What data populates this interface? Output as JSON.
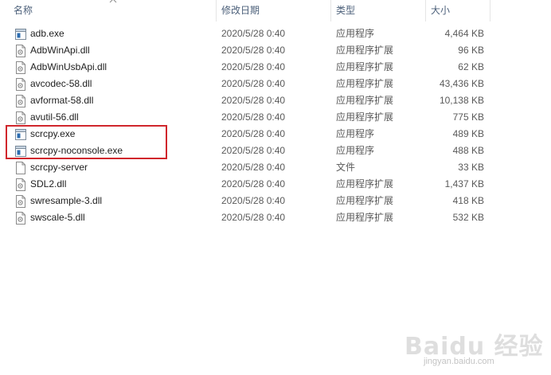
{
  "columns": {
    "name": "名称",
    "date": "修改日期",
    "type": "类型",
    "size": "大小"
  },
  "files": [
    {
      "name": "adb.exe",
      "date": "2020/5/28 0:40",
      "type": "应用程序",
      "size": "4,464 KB",
      "icon": "exe-icon"
    },
    {
      "name": "AdbWinApi.dll",
      "date": "2020/5/28 0:40",
      "type": "应用程序扩展",
      "size": "96 KB",
      "icon": "dll-icon"
    },
    {
      "name": "AdbWinUsbApi.dll",
      "date": "2020/5/28 0:40",
      "type": "应用程序扩展",
      "size": "62 KB",
      "icon": "dll-icon"
    },
    {
      "name": "avcodec-58.dll",
      "date": "2020/5/28 0:40",
      "type": "应用程序扩展",
      "size": "43,436 KB",
      "icon": "dll-icon"
    },
    {
      "name": "avformat-58.dll",
      "date": "2020/5/28 0:40",
      "type": "应用程序扩展",
      "size": "10,138 KB",
      "icon": "dll-icon"
    },
    {
      "name": "avutil-56.dll",
      "date": "2020/5/28 0:40",
      "type": "应用程序扩展",
      "size": "775 KB",
      "icon": "dll-icon"
    },
    {
      "name": "scrcpy.exe",
      "date": "2020/5/28 0:40",
      "type": "应用程序",
      "size": "489 KB",
      "icon": "exe-icon"
    },
    {
      "name": "scrcpy-noconsole.exe",
      "date": "2020/5/28 0:40",
      "type": "应用程序",
      "size": "488 KB",
      "icon": "exe-icon"
    },
    {
      "name": "scrcpy-server",
      "date": "2020/5/28 0:40",
      "type": "文件",
      "size": "33 KB",
      "icon": "file-icon"
    },
    {
      "name": "SDL2.dll",
      "date": "2020/5/28 0:40",
      "type": "应用程序扩展",
      "size": "1,437 KB",
      "icon": "dll-icon"
    },
    {
      "name": "swresample-3.dll",
      "date": "2020/5/28 0:40",
      "type": "应用程序扩展",
      "size": "418 KB",
      "icon": "dll-icon"
    },
    {
      "name": "swscale-5.dll",
      "date": "2020/5/28 0:40",
      "type": "应用程序扩展",
      "size": "532 KB",
      "icon": "dll-icon"
    }
  ],
  "watermark": {
    "logo": "Baidu 经验",
    "url": "jingyan.baidu.com"
  },
  "colors": {
    "highlight": "#d0262c",
    "header_text": "#4c607a"
  }
}
